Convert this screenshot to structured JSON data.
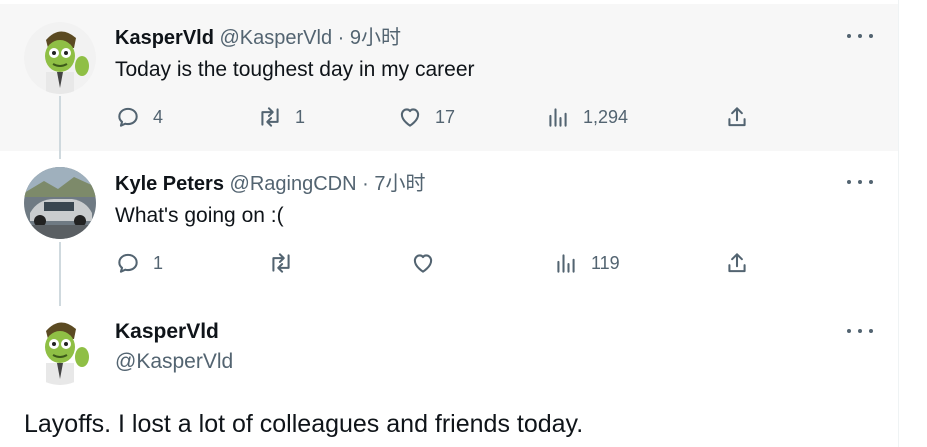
{
  "tweets": [
    {
      "name": "KasperVld",
      "handle": "@KasperVld",
      "time": " · 9小时",
      "text": "Today is the toughest day in my career",
      "replies": "4",
      "retweets": "1",
      "likes": "17",
      "views": "1,294"
    },
    {
      "name": "Kyle Peters",
      "handle": "@RagingCDN",
      "time": " · 7小时",
      "text": "What's going  on :(",
      "replies": "1",
      "retweets": "",
      "likes": "",
      "views": "119"
    }
  ],
  "main_tweet": {
    "name": "KasperVld",
    "handle": "@KasperVld",
    "text": "Layoffs. I lost a lot of colleagues and friends today."
  },
  "icons": {
    "reply": "reply-icon",
    "retweet": "retweet-icon",
    "like": "heart-icon",
    "views": "views-icon",
    "share": "share-icon",
    "more": "more-icon"
  },
  "colors": {
    "highlight_bg": "#f7f7f7",
    "secondary_text": "#536471",
    "thread_line": "#cfd9de"
  }
}
